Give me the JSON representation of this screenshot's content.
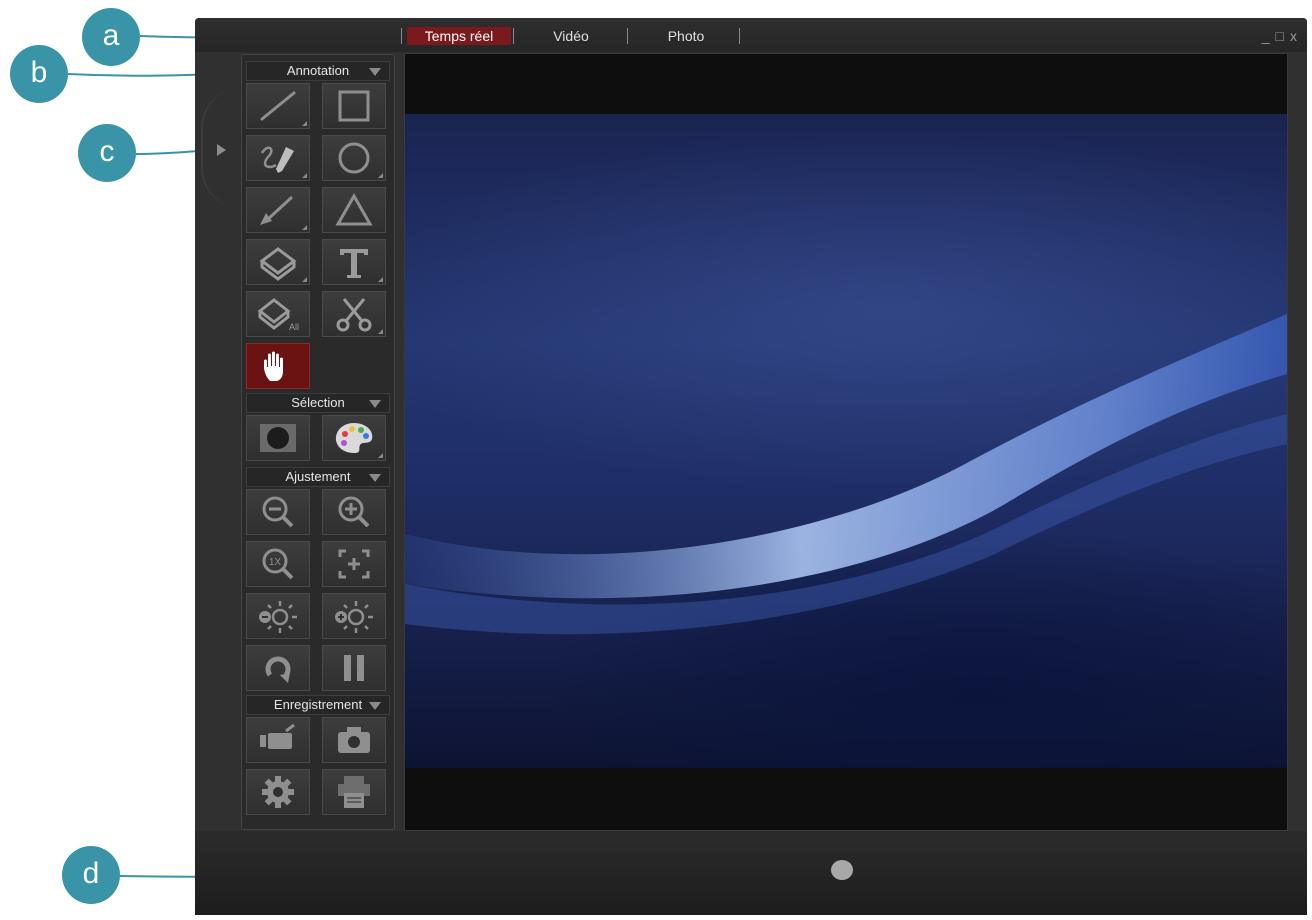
{
  "tabs": [
    {
      "label": "Temps réel",
      "active": true
    },
    {
      "label": "Vidéo",
      "active": false
    },
    {
      "label": "Photo",
      "active": false
    }
  ],
  "window_controls": {
    "minimize": "_",
    "maximize": "□",
    "close": "x"
  },
  "sections": {
    "annotation": "Annotation",
    "selection": "Sélection",
    "ajustement": "Ajustement",
    "enregistrement": "Enregistrement"
  },
  "tools": {
    "annotation": [
      "line-icon",
      "square-icon",
      "freehand-pen-icon",
      "circle-icon",
      "arrow-icon",
      "triangle-icon",
      "eraser-icon",
      "text-icon",
      "eraser-all-icon",
      "scissors-icon",
      "hand-icon"
    ],
    "selection": [
      "spotlight-icon",
      "palette-icon"
    ],
    "ajustement": [
      "zoom-out-icon",
      "zoom-in-icon",
      "zoom-1x-icon",
      "fit-screen-icon",
      "brightness-down-icon",
      "brightness-up-icon",
      "rotate-icon",
      "pause-icon"
    ],
    "enregistrement": [
      "video-record-icon",
      "camera-icon",
      "settings-icon",
      "printer-icon"
    ]
  },
  "eraser_all_label": "All",
  "zoom_1x_label": "1X",
  "callouts": [
    "a",
    "b",
    "c",
    "d"
  ],
  "colors": {
    "accent_red": "#7b1a1c",
    "callout_teal": "#3a94a8",
    "window_bg": "#303030"
  }
}
